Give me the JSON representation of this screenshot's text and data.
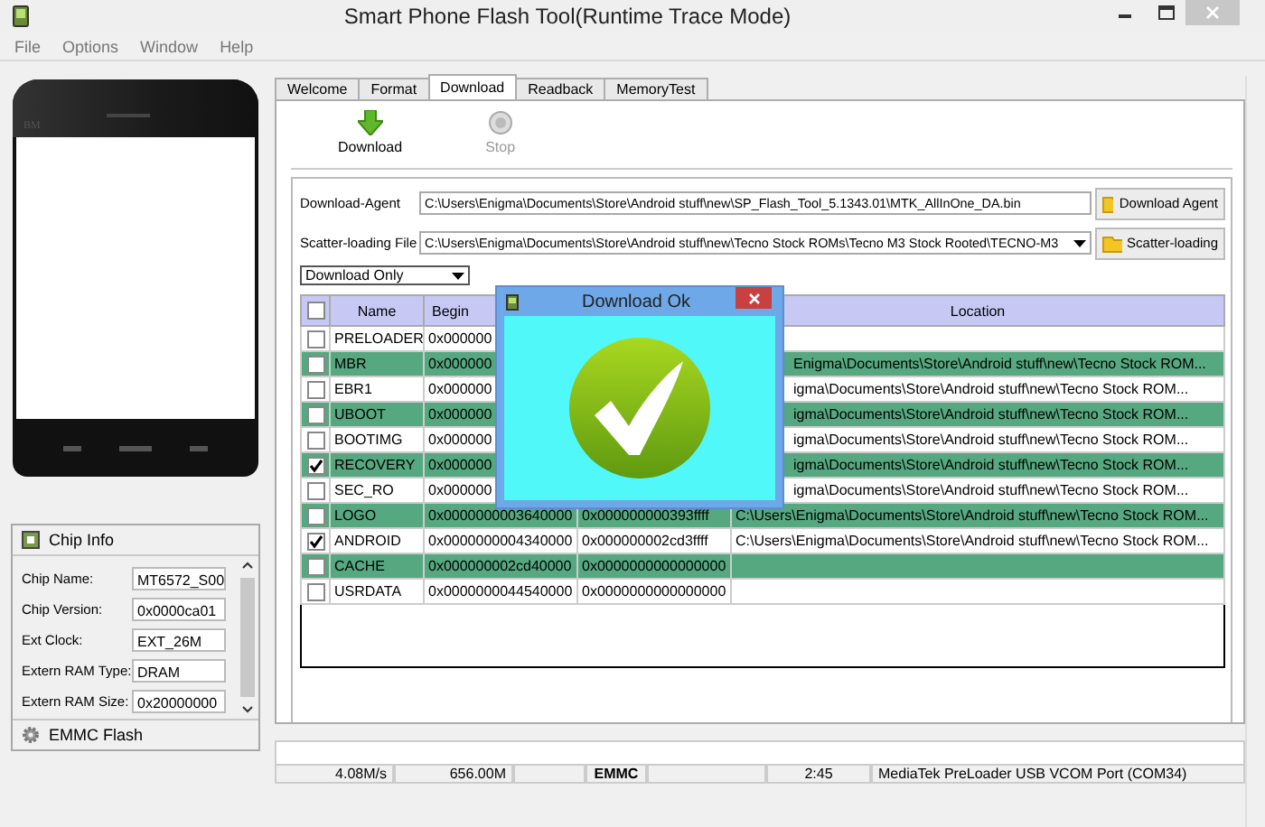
{
  "window": {
    "title": "Smart Phone Flash Tool(Runtime Trace Mode)"
  },
  "menu": [
    "File",
    "Options",
    "Window",
    "Help"
  ],
  "phone": {
    "brand": "BM"
  },
  "chip_info": {
    "title": "Chip Info",
    "fields": [
      {
        "label": "Chip Name:",
        "value": "MT6572_S00"
      },
      {
        "label": "Chip Version:",
        "value": "0x0000ca01"
      },
      {
        "label": "Ext Clock:",
        "value": "EXT_26M"
      },
      {
        "label": "Extern RAM Type:",
        "value": "DRAM"
      },
      {
        "label": "Extern RAM Size:",
        "value": "0x20000000"
      }
    ],
    "footer": "EMMC Flash"
  },
  "tabs": [
    {
      "label": "Welcome",
      "selected": false
    },
    {
      "label": "Format",
      "selected": false
    },
    {
      "label": "Download",
      "selected": true
    },
    {
      "label": "Readback",
      "selected": false
    },
    {
      "label": "MemoryTest",
      "selected": false
    }
  ],
  "toolbar": [
    {
      "label": "Download",
      "kind": "download",
      "disabled": false
    },
    {
      "label": "Stop",
      "kind": "stop",
      "disabled": true
    }
  ],
  "download_agent": {
    "label": "Download-Agent",
    "value": "C:\\Users\\Enigma\\Documents\\Store\\Android stuff\\new\\SP_Flash_Tool_5.1343.01\\MTK_AllInOne_DA.bin",
    "button": "Download Agent"
  },
  "scatter_file": {
    "label": "Scatter-loading File",
    "value": "C:\\Users\\Enigma\\Documents\\Store\\Android stuff\\new\\Tecno Stock ROMs\\Tecno M3 Stock Rooted\\TECNO-M3",
    "button": "Scatter-loading"
  },
  "mode": {
    "value": "Download Only"
  },
  "table": {
    "columns": {
      "name": "Name",
      "begin": "Begin",
      "location": "Location"
    },
    "header_checked": false,
    "rows": [
      {
        "checked": false,
        "name": "PRELOADER",
        "begin": "0x000000"
      },
      {
        "checked": false,
        "name": "MBR",
        "begin": "0x000000",
        "location": "Enigma\\Documents\\Store\\Android stuff\\new\\Tecno Stock ROM..."
      },
      {
        "checked": false,
        "name": "EBR1",
        "begin": "0x000000",
        "location": "igma\\Documents\\Store\\Android stuff\\new\\Tecno Stock ROM..."
      },
      {
        "checked": false,
        "name": "UBOOT",
        "begin": "0x000000",
        "location": "igma\\Documents\\Store\\Android stuff\\new\\Tecno Stock ROM..."
      },
      {
        "checked": false,
        "name": "BOOTIMG",
        "begin": "0x000000",
        "location": "igma\\Documents\\Store\\Android stuff\\new\\Tecno Stock ROM..."
      },
      {
        "checked": true,
        "name": "RECOVERY",
        "begin": "0x000000",
        "location": "igma\\Documents\\Store\\Android stuff\\new\\Tecno Stock ROM..."
      },
      {
        "checked": false,
        "name": "SEC_RO",
        "begin": "0x000000",
        "location": "igma\\Documents\\Store\\Android stuff\\new\\Tecno Stock ROM..."
      },
      {
        "checked": false,
        "name": "LOGO",
        "begin": "0x0000000003640000",
        "end": "0x000000000393ffff",
        "location": "C:\\Users\\Enigma\\Documents\\Store\\Android stuff\\new\\Tecno Stock ROM..."
      },
      {
        "checked": true,
        "name": "ANDROID",
        "begin": "0x0000000004340000",
        "end": "0x000000002cd3ffff",
        "location": "C:\\Users\\Enigma\\Documents\\Store\\Android stuff\\new\\Tecno Stock ROM..."
      },
      {
        "checked": false,
        "name": "CACHE",
        "begin": "0x000000002cd40000",
        "end": "0x0000000000000000"
      },
      {
        "checked": false,
        "name": "USRDATA",
        "begin": "0x0000000044540000",
        "end": "0x0000000000000000"
      }
    ]
  },
  "dialog": {
    "title": "Download Ok"
  },
  "progress": {
    "level": 0
  },
  "status_bar": {
    "speed": "4.08M/s",
    "size": "656.00M",
    "storage": "EMMC",
    "time": "2:45",
    "port": "MediaTek PreLoader USB VCOM Port (COM34)"
  }
}
